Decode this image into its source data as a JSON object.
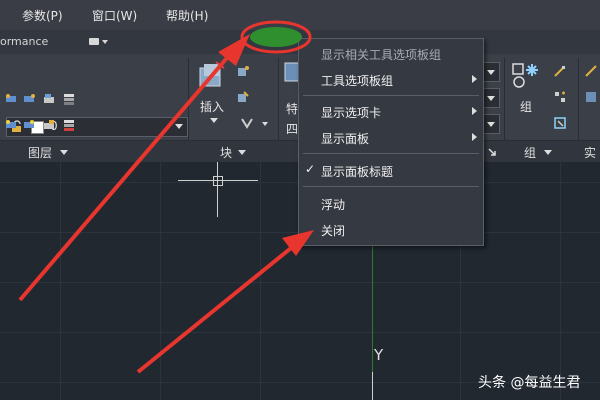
{
  "menubar": {
    "items": [
      "参数(P)",
      "窗口(W)",
      "帮助(H)"
    ]
  },
  "workspace": {
    "label": "ormance"
  },
  "layer": {
    "current": "0"
  },
  "ribbon": {
    "insert_label": "插入",
    "group_label": "组",
    "panels": {
      "layers": "图层",
      "block": "块",
      "group": "组",
      "utilities": "实"
    },
    "truncated_labels": [
      "特",
      "四"
    ]
  },
  "context_menu": {
    "items": [
      {
        "label": "显示相关工具选项板组",
        "disabled": true
      },
      {
        "label": "工具选项板组",
        "submenu": true
      },
      {
        "label": "显示选项卡",
        "submenu": true
      },
      {
        "label": "显示面板",
        "submenu": true
      },
      {
        "label": "显示面板标题",
        "checked": true
      },
      {
        "label": "浮动"
      },
      {
        "label": "关闭"
      }
    ],
    "check_glyph": "✓"
  },
  "drawing": {
    "y_axis_label": "Y"
  },
  "watermark": "头条 @每益生君",
  "colors": {
    "annotation_red": "#e8352e",
    "highlight_green": "#2f8f2f",
    "drawing_bg": "#212830"
  }
}
